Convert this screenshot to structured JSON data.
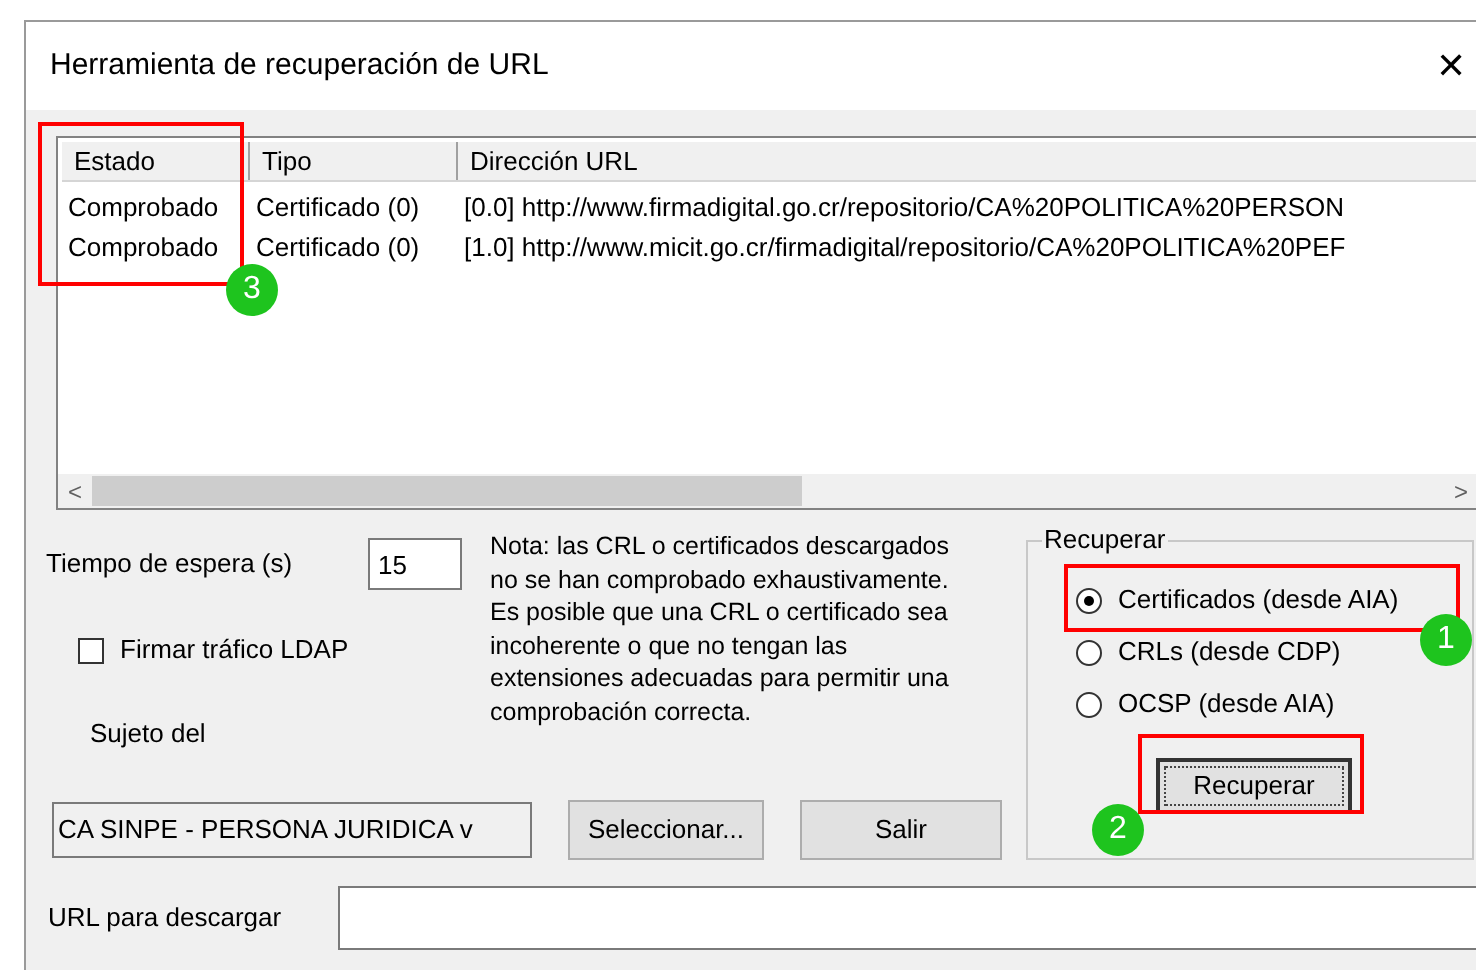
{
  "window": {
    "title": "Herramienta de recuperación de URL",
    "close": "✕"
  },
  "table": {
    "columns": [
      "Estado",
      "Tipo",
      "Dirección URL"
    ],
    "rows": [
      [
        "Comprobado",
        "Certificado (0)",
        "[0.0] http://www.firmadigital.go.cr/repositorio/CA%20POLITICA%20PERSON"
      ],
      [
        "Comprobado",
        "Certificado (0)",
        "[1.0] http://www.micit.go.cr/firmadigital/repositorio/CA%20POLITICA%20PEF"
      ]
    ],
    "scroll_left": "<",
    "scroll_right": ">"
  },
  "timeout": {
    "label": "Tiempo de espera (s)",
    "value": "15"
  },
  "note": "Nota: las CRL o certificados descargados no se han comprobado exhaustivamente. Es posible que una CRL o certificado sea incoherente o que no tengan las extensiones adecuadas para permitir una comprobación correcta.",
  "sign_ldap": {
    "label": "Firmar tráfico LDAP",
    "checked": false
  },
  "subject": {
    "label": "Sujeto del",
    "value": "CA SINPE - PERSONA JURIDICA v"
  },
  "buttons": {
    "select": "Seleccionar...",
    "exit": "Salir",
    "retrieve": "Recuperar"
  },
  "retrieve_group": {
    "title": "Recuperar",
    "options": [
      {
        "label": "Certificados (desde AIA)",
        "selected": true
      },
      {
        "label": "CRLs (desde CDP)",
        "selected": false
      },
      {
        "label": "OCSP (desde AIA)",
        "selected": false
      }
    ]
  },
  "url_download": {
    "label": "URL para descargar"
  },
  "callouts": [
    {
      "label": "1"
    },
    {
      "label": "2"
    },
    {
      "label": "3"
    }
  ]
}
